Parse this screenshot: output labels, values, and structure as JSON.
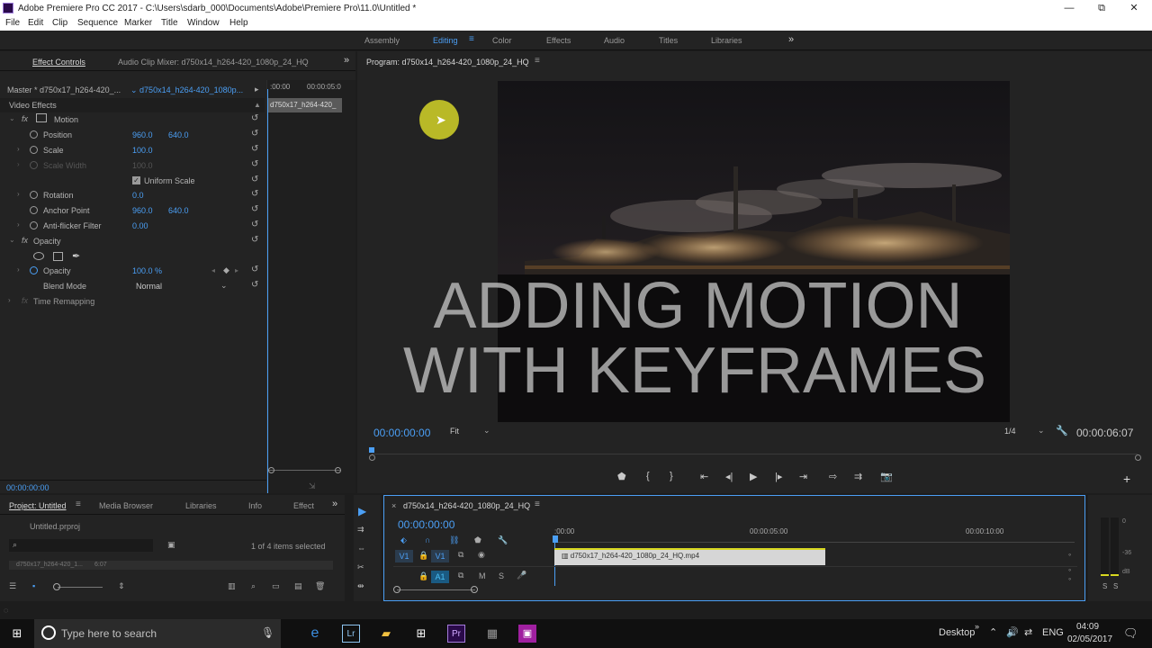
{
  "window": {
    "title": "Adobe Premiere Pro CC 2017 - C:\\Users\\sdarb_000\\Documents\\Adobe\\Premiere Pro\\11.0\\Untitled *",
    "minimize": "—",
    "maximize": "⧉",
    "close": "✕"
  },
  "menu": [
    "File",
    "Edit",
    "Clip",
    "Sequence",
    "Marker",
    "Title",
    "Window",
    "Help"
  ],
  "workspaces": {
    "items": [
      "Assembly",
      "Editing",
      "Color",
      "Effects",
      "Audio",
      "Titles",
      "Libraries"
    ],
    "active": "Editing",
    "more": "»"
  },
  "effect_controls": {
    "tab_effect_controls": "Effect Controls",
    "tab_audio_mixer": "Audio Clip Mixer: d750x14_h264-420_1080p_24_HQ",
    "more": "»",
    "master_label": "Master * d750x17_h264-420_...",
    "clip_select": "d750x14_h264-420_1080p...",
    "ruler_start": ":00:00",
    "ruler_end": "00:00:05:0",
    "clip_bar": "d750x17_h264-420_",
    "section_video": "Video Effects",
    "motion": "Motion",
    "position_label": "Position",
    "position_x": "960.0",
    "position_y": "640.0",
    "scale_label": "Scale",
    "scale_value": "100.0",
    "scale_width_label": "Scale Width",
    "scale_width_value": "100.0",
    "uniform_scale": "Uniform Scale",
    "rotation_label": "Rotation",
    "rotation_value": "0.0",
    "anchor_label": "Anchor Point",
    "anchor_x": "960.0",
    "anchor_y": "640.0",
    "antiflicker_label": "Anti-flicker Filter",
    "antiflicker_value": "0.00",
    "opacity_section": "Opacity",
    "opacity_label": "Opacity",
    "opacity_value": "100.0 %",
    "blend_label": "Blend Mode",
    "blend_value": "Normal",
    "time_remap": "Time Remapping",
    "timecode": "00:00:00:00"
  },
  "program": {
    "title": "Program: d750x14_h264-420_1080p_24_HQ",
    "overlay_line1": "ADDING MOTION",
    "overlay_line2": "WITH KEYFRAMES",
    "timecode": "00:00:00:00",
    "fit": "Fit",
    "resolution": "1/4",
    "duration": "00:00:06:07"
  },
  "project": {
    "tabs": [
      "Project: Untitled",
      "Media Browser",
      "Libraries",
      "Info",
      "Effect"
    ],
    "more": "»",
    "file": "Untitled.prproj",
    "selection": "1 of 4 items selected",
    "item_name": "d750x17_h264-420_1...",
    "item_dur": "6:07"
  },
  "timeline": {
    "title": "d750x14_h264-420_1080p_24_HQ",
    "timecode": "00:00:00:00",
    "ruler": [
      ":00:00",
      "00:00:05:00",
      "00:00:10:00"
    ],
    "track_v1_src": "V1",
    "track_v1": "V1",
    "track_a1": "A1",
    "mute": "M",
    "solo": "S",
    "clip_name": "d750x17_h264-420_1080p_24_HQ.mp4"
  },
  "meters": {
    "labels": [
      "0",
      "-36",
      "dB"
    ],
    "solo": [
      "S",
      "S"
    ]
  },
  "taskbar": {
    "search_placeholder": "Type here to search",
    "desktop": "Desktop",
    "lang": "ENG",
    "time": "04:09",
    "date": "02/05/2017"
  },
  "colors": {
    "accent": "#4b9ff5",
    "clip_bar": "#d6d6d6",
    "cursor_highlight": "#d8d820",
    "panel": "#232323"
  }
}
